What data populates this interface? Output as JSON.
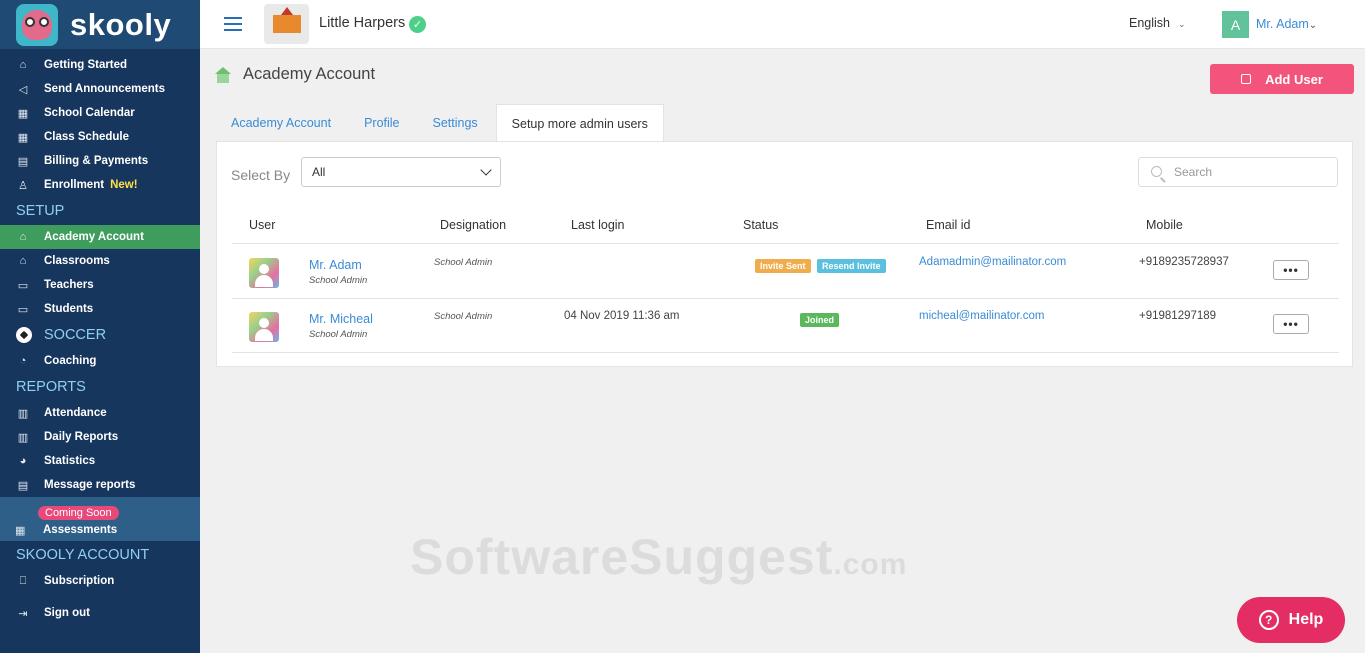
{
  "app": {
    "name": "skooly"
  },
  "sidebar": {
    "main_items": [
      {
        "label": "Getting Started",
        "icon": "home-icon"
      },
      {
        "label": "Send Announcements",
        "icon": "megaphone-icon"
      },
      {
        "label": "School Calendar",
        "icon": "calendar-icon"
      },
      {
        "label": "Class Schedule",
        "icon": "calendar-icon"
      },
      {
        "label": "Billing & Payments",
        "icon": "billing-icon"
      },
      {
        "label": "Enrollment",
        "icon": "enrollment-icon",
        "badge": "New!"
      }
    ],
    "setup": {
      "title": "SETUP",
      "items": [
        {
          "label": "Academy Account",
          "icon": "school-icon",
          "active": true
        },
        {
          "label": "Classrooms",
          "icon": "classroom-icon"
        },
        {
          "label": "Teachers",
          "icon": "teacher-icon"
        },
        {
          "label": "Students",
          "icon": "student-icon"
        }
      ]
    },
    "soccer": {
      "title": "SOCCER",
      "items": [
        {
          "label": "Coaching",
          "icon": "whistle-icon"
        }
      ]
    },
    "reports": {
      "title": "REPORTS",
      "items": [
        {
          "label": "Attendance",
          "icon": "clipboard-icon"
        },
        {
          "label": "Daily Reports",
          "icon": "clipboard-icon"
        },
        {
          "label": "Statistics",
          "icon": "pie-chart-icon"
        },
        {
          "label": "Message reports",
          "icon": "message-icon"
        }
      ],
      "assessments": {
        "label": "Assessments",
        "badge": "Coming Soon"
      }
    },
    "account": {
      "title": "SKOOLY ACCOUNT",
      "items": [
        {
          "label": "Subscription",
          "icon": "bookmark-icon"
        },
        {
          "label": "Sign out",
          "icon": "sign-out-icon"
        }
      ]
    }
  },
  "topbar": {
    "school_name": "Little Harpers",
    "language": "English",
    "user_initial": "A",
    "user_name": "Mr. Adam"
  },
  "page": {
    "title": "Academy Account",
    "add_user_label": "Add User",
    "tabs": [
      {
        "label": "Academy Account"
      },
      {
        "label": "Profile"
      },
      {
        "label": "Settings"
      },
      {
        "label": "Setup more admin users",
        "active": true
      }
    ],
    "filter": {
      "label": "Select By",
      "value": "All"
    },
    "search": {
      "placeholder": "Search"
    },
    "columns": [
      "User",
      "Designation",
      "Last login",
      "Status",
      "Email id",
      "Mobile"
    ],
    "rows": [
      {
        "name": "Mr. Adam",
        "role": "School Admin",
        "designation": "School Admin",
        "last_login": "",
        "status": [
          "Invite Sent",
          "Resend Invite"
        ],
        "email": "Adamadmin@mailinator.com",
        "mobile": "+9189235728937",
        "more": "•••"
      },
      {
        "name": "Mr. Micheal",
        "role": "School Admin",
        "designation": "School Admin",
        "last_login": "04 Nov 2019 11:36 am",
        "status": [
          "Joined"
        ],
        "email": "micheal@mailinator.com",
        "mobile": "+91981297189",
        "more": "•••"
      }
    ]
  },
  "watermark": {
    "main": "SoftwareSuggest",
    "suffix": ".com"
  },
  "help": {
    "label": "Help"
  },
  "colors": {
    "sidebar": "#17365d",
    "active": "#3e9c5c",
    "accent": "#f2547b",
    "link": "#3a8bd6"
  }
}
